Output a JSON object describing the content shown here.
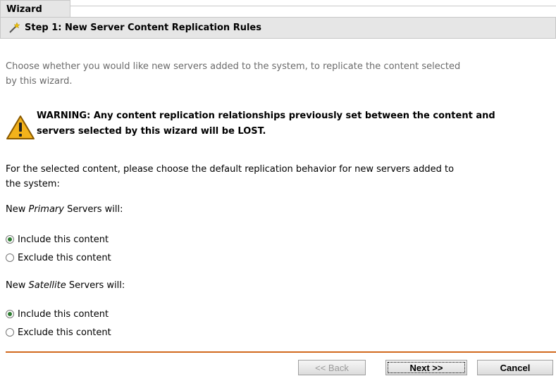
{
  "header": {
    "title": "Wizard"
  },
  "step": {
    "title": "Step 1: New Server Content Replication Rules"
  },
  "intro": {
    "line1": "Choose whether you would like new servers added to the system, to replicate the content selected",
    "line2": "by this wizard."
  },
  "warning": {
    "line1": "WARNING: Any content replication relationships previously set between the content and",
    "line2": "servers selected by this wizard will be LOST."
  },
  "description": {
    "line1": "For the selected content, please choose the default replication behavior for new servers added to",
    "line2": "the system:"
  },
  "primary": {
    "prefix": "New ",
    "emph": "Primary",
    "suffix": " Servers will:",
    "options": [
      {
        "label": "Include this content",
        "checked": true
      },
      {
        "label": "Exclude this content",
        "checked": false
      }
    ]
  },
  "satellite": {
    "prefix": "New ",
    "emph": "Satellite",
    "suffix": " Servers will:",
    "options": [
      {
        "label": "Include this content",
        "checked": true
      },
      {
        "label": "Exclude this content",
        "checked": false
      }
    ]
  },
  "buttons": {
    "back": "<< Back",
    "next": "Next >>",
    "cancel": "Cancel"
  },
  "colors": {
    "accent": "#d2691e",
    "header_bg": "#e6e6e6",
    "intro_text": "#6a6a6a",
    "radio_checked": "#2e7d32"
  }
}
